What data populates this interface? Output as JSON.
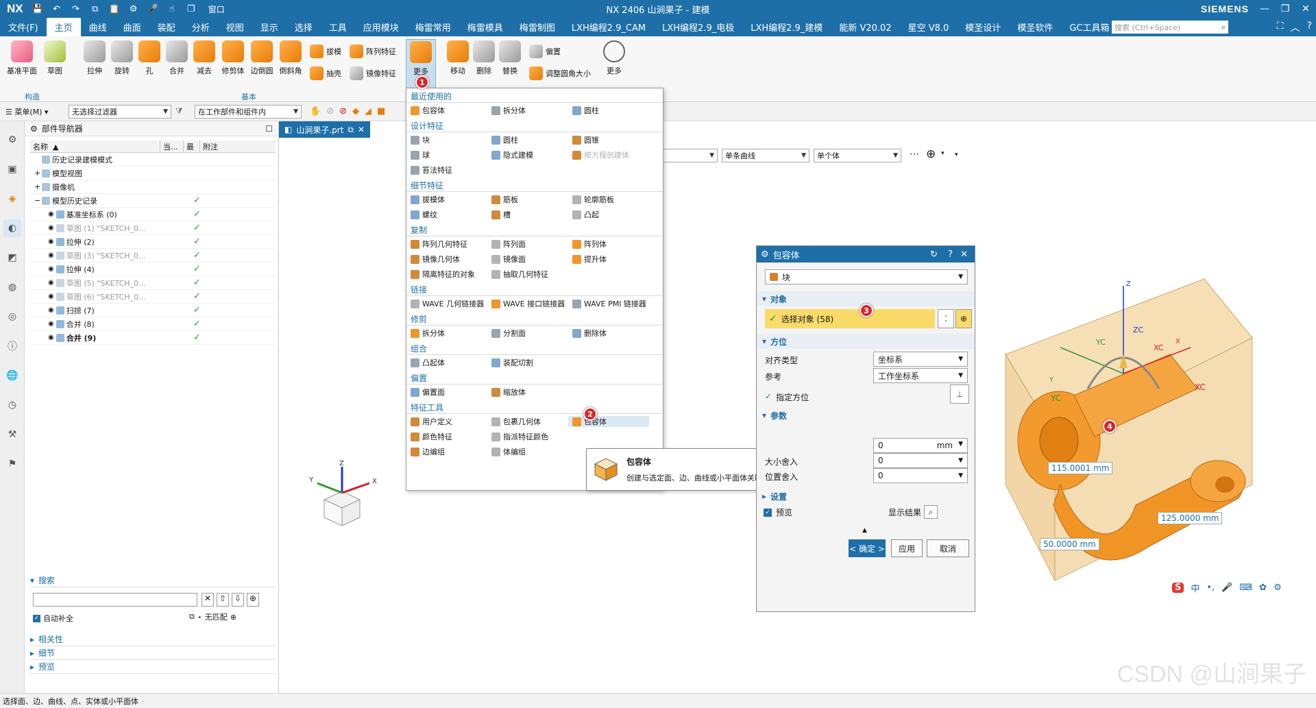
{
  "app": {
    "logo": "NX",
    "window_title": "NX 2406 山涧果子 - 建模",
    "brand": "SIEMENS",
    "accent": "#1e6fa8"
  },
  "menubar": {
    "file": "文件(F)",
    "tabs": [
      "主页",
      "曲线",
      "曲面",
      "装配",
      "分析",
      "视图",
      "显示",
      "选择",
      "工具",
      "应用模块",
      "梅雷常用",
      "梅雷模具",
      "梅雷制图",
      "LXH编程2.9_CAM",
      "LXH编程2.9_电极",
      "LXH编程2.9_建模",
      "能新 V20.02",
      "星空 V8.0",
      "模圣设计",
      "模圣软件",
      "GC工具箱"
    ],
    "search_placeholder": "搜索 (Ctrl+Space)",
    "window_menu": "窗口"
  },
  "ribbon": {
    "construct": {
      "label": "构造",
      "items": [
        "基准平面",
        "草图"
      ]
    },
    "basic": {
      "label": "基本",
      "big": [
        "拉伸",
        "旋转",
        "孔",
        "合并",
        "减去",
        "修剪体",
        "边倒圆",
        "倒斜角"
      ],
      "small": [
        "拔模",
        "阵列特征",
        "抽壳",
        "镜像特征"
      ],
      "more": "更多"
    },
    "sync": {
      "items": [
        "移动",
        "删除",
        "替换"
      ],
      "small": [
        "偏置",
        "调整圆角大小"
      ],
      "more": "更多"
    }
  },
  "selection_bar": {
    "menu": "菜单(M)",
    "filter": "无选择过滤器",
    "scope": "在工作部件和组件内"
  },
  "graphics_bar": {
    "curve_rule": "单条曲线",
    "body_rule": "单个体"
  },
  "navigator": {
    "title": "部件导航器",
    "columns": [
      "名称",
      "当...",
      "最",
      "附注"
    ],
    "rows": [
      {
        "name": "历史记录建模模式",
        "level": 0,
        "dim": false,
        "check": false
      },
      {
        "name": "模型视图",
        "level": 0,
        "dim": false,
        "check": false
      },
      {
        "name": "摄像机",
        "level": 0,
        "dim": false,
        "check": false
      },
      {
        "name": "模型历史记录",
        "level": 0,
        "dim": false,
        "check": true
      },
      {
        "name": "基准坐标系 (0)",
        "level": 1,
        "dim": false,
        "check": true
      },
      {
        "name": "草图 (1) \"SKETCH_0...",
        "level": 1,
        "dim": true,
        "check": true
      },
      {
        "name": "拉伸 (2)",
        "level": 1,
        "dim": false,
        "check": true
      },
      {
        "name": "草图 (3) \"SKETCH_0...",
        "level": 1,
        "dim": true,
        "check": true
      },
      {
        "name": "拉伸 (4)",
        "level": 1,
        "dim": false,
        "check": true
      },
      {
        "name": "草图 (5) \"SKETCH_0...",
        "level": 1,
        "dim": true,
        "check": true
      },
      {
        "name": "草图 (6) \"SKETCH_0...",
        "level": 1,
        "dim": true,
        "check": true
      },
      {
        "name": "扫掠 (7)",
        "level": 1,
        "dim": false,
        "check": true
      },
      {
        "name": "合并 (8)",
        "level": 1,
        "dim": false,
        "check": true
      },
      {
        "name": "合并 (9)",
        "level": 1,
        "dim": false,
        "check": true,
        "bold": true
      }
    ],
    "search": {
      "title": "搜索",
      "auto_complete": "自动补全",
      "no_match": "无匹配"
    },
    "sections": [
      "相关性",
      "细节",
      "预览"
    ]
  },
  "graphics": {
    "tab": "山涧果子.prt",
    "triad": {
      "x": "X",
      "y": "Y",
      "z": "Z"
    }
  },
  "dropdown": {
    "sections": [
      {
        "title": "最近使用的",
        "rows": [
          [
            "包容体",
            "拆分体",
            "圆柱"
          ]
        ]
      },
      {
        "title": "设计特征",
        "rows": [
          [
            "块",
            "圆柱",
            "圆锥"
          ],
          [
            "球",
            "隐式建模",
            "按方程创建体"
          ]
        ],
        "tail": [
          "笞法特征"
        ]
      },
      {
        "title": "细节特征",
        "rows": [
          [
            "拔模体",
            "筋板",
            "轮廓筋板"
          ],
          [
            "螺纹",
            "槽",
            "凸起"
          ]
        ]
      },
      {
        "title": "复制",
        "rows": [
          [
            "阵列几何特征",
            "阵列面",
            "阵列体"
          ],
          [
            "镜像几何体",
            "镜像面",
            "提升体"
          ],
          [
            "隔离特征的对象",
            "抽取几何特征",
            ""
          ]
        ]
      },
      {
        "title": "链接",
        "rows": [
          [
            "WAVE 几何链接器",
            "WAVE 接口链接器",
            "WAVE PMI 链接器"
          ]
        ]
      },
      {
        "title": "修剪",
        "rows": [
          [
            "拆分体",
            "分割面",
            "删除体"
          ]
        ]
      },
      {
        "title": "组合",
        "rows": [
          [
            "凸起体",
            "装配切割",
            ""
          ]
        ]
      },
      {
        "title": "偏置",
        "rows": [
          [
            "偏置面",
            "缩放体",
            ""
          ]
        ]
      },
      {
        "title": "特征工具",
        "rows": [
          [
            "用户定义",
            "包裹几何体",
            "包容体"
          ],
          [
            "颜色特征",
            "指派特征颜色",
            ""
          ],
          [
            "边编组",
            "体编组",
            ""
          ]
        ]
      }
    ]
  },
  "tooltip": {
    "title": "包容体",
    "desc": "创建与选定面、边、曲线或小平面体关联的方块。"
  },
  "dialog": {
    "title": "包容体",
    "type": "块",
    "object_section": "对象",
    "select_object": "选择对象 (58)",
    "orientation_section": "方位",
    "align_label": "对齐类型",
    "align_value": "坐标系",
    "ref_label": "参考",
    "ref_value": "工作坐标系",
    "specify_orient": "指定方位",
    "params_section": "参数",
    "gap_value": "0",
    "gap_unit": "mm",
    "size_round_label": "大小舍入",
    "size_round_value": "0",
    "pos_round_label": "位置舍入",
    "pos_round_value": "0",
    "settings_section": "设置",
    "preview": "预览",
    "show_result": "显示结果",
    "ok": "< 确定 >",
    "apply": "应用",
    "cancel": "取消"
  },
  "model": {
    "dim1": "115.0001 mm",
    "dim2": "125.0000 mm",
    "dim3": "50.0000 mm",
    "axes": {
      "xc": "XC",
      "yc": "YC",
      "zc": "ZC",
      "x": "X",
      "y": "Y",
      "z": "Z"
    }
  },
  "badges": [
    "1",
    "2",
    "3",
    "4"
  ],
  "status": "选择面、边、曲线、点、实体或小平面体",
  "watermark": "CSDN @山涧果子",
  "ime": "中"
}
